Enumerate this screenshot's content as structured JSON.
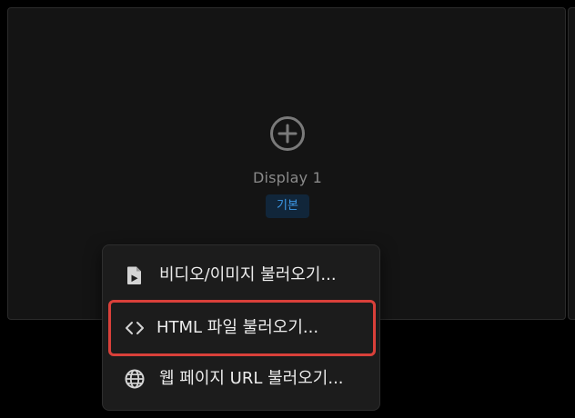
{
  "display": {
    "title": "Display 1",
    "badge": "기본",
    "add_icon": "plus-circle-icon"
  },
  "menu": {
    "items": [
      {
        "label": "비디오/이미지 불러오기...",
        "icon": "file-media-icon",
        "highlighted": false
      },
      {
        "label": "HTML 파일 불러오기...",
        "icon": "code-icon",
        "highlighted": true
      },
      {
        "label": "웹 페이지 URL 불러오기...",
        "icon": "globe-icon",
        "highlighted": false
      }
    ]
  },
  "colors": {
    "background": "#000000",
    "panel": "#141414",
    "menu": "#1c1c1c",
    "badge_text": "#3e9bea",
    "badge_bg": "#11263a",
    "highlight_border": "#d9403a"
  }
}
